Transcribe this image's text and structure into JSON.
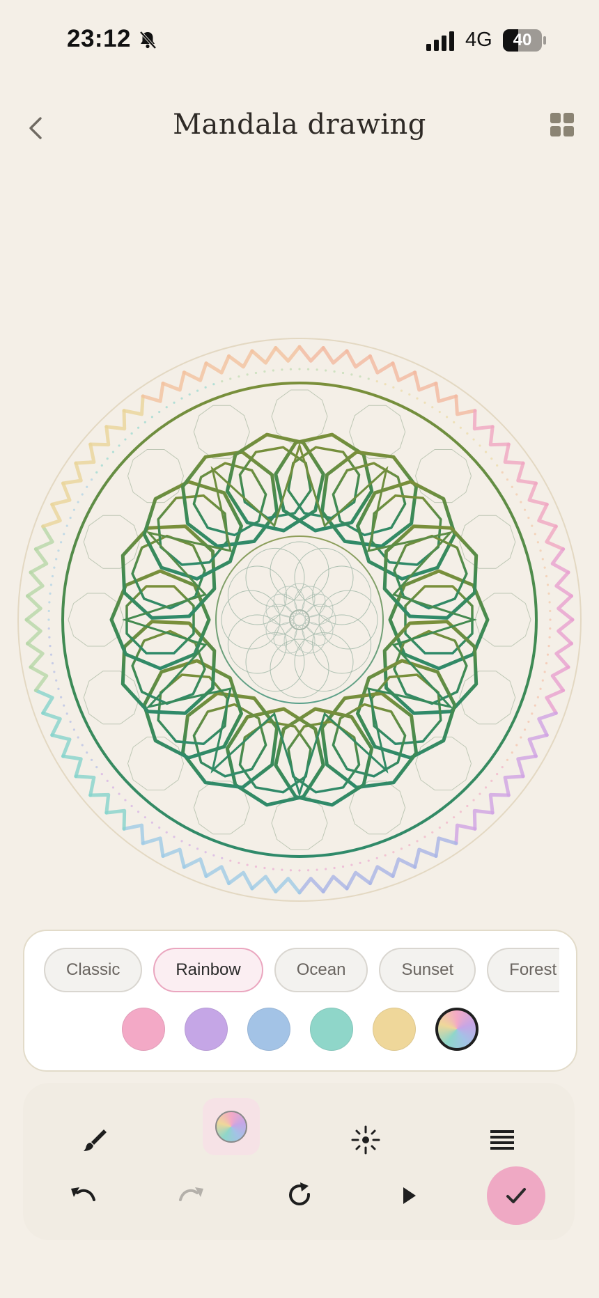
{
  "status_bar": {
    "time": "23:12",
    "network": "4G",
    "battery": "40",
    "battery_level": 0.4
  },
  "header": {
    "title": "Mandala drawing"
  },
  "palette": {
    "chips": [
      {
        "label": "Classic",
        "selected": false
      },
      {
        "label": "Rainbow",
        "selected": true
      },
      {
        "label": "Ocean",
        "selected": false
      },
      {
        "label": "Sunset",
        "selected": false
      },
      {
        "label": "Forest",
        "selected": false
      }
    ],
    "swatches": [
      {
        "name": "pink",
        "color": "#f3a9c6"
      },
      {
        "name": "lavender",
        "color": "#c5a6e6"
      },
      {
        "name": "blue",
        "color": "#a3c3e6"
      },
      {
        "name": "teal",
        "color": "#8fd6c9"
      },
      {
        "name": "yellow",
        "color": "#efd79a"
      },
      {
        "name": "rainbow",
        "color": "rainbow",
        "selected": true
      }
    ]
  },
  "toolbar": {
    "row1": [
      "brush-icon",
      "palette-icon",
      "sparkle-icon",
      "lines-icon"
    ],
    "row2": [
      "undo-icon",
      "redo-icon",
      "refresh-icon",
      "play-icon"
    ],
    "confirm": "check-icon"
  },
  "colors": {
    "background": "#f4efe7",
    "accent": "#efa9c4",
    "mandala_green_top": "#7a8f3a",
    "mandala_green_bottom": "#2f8a6a"
  }
}
